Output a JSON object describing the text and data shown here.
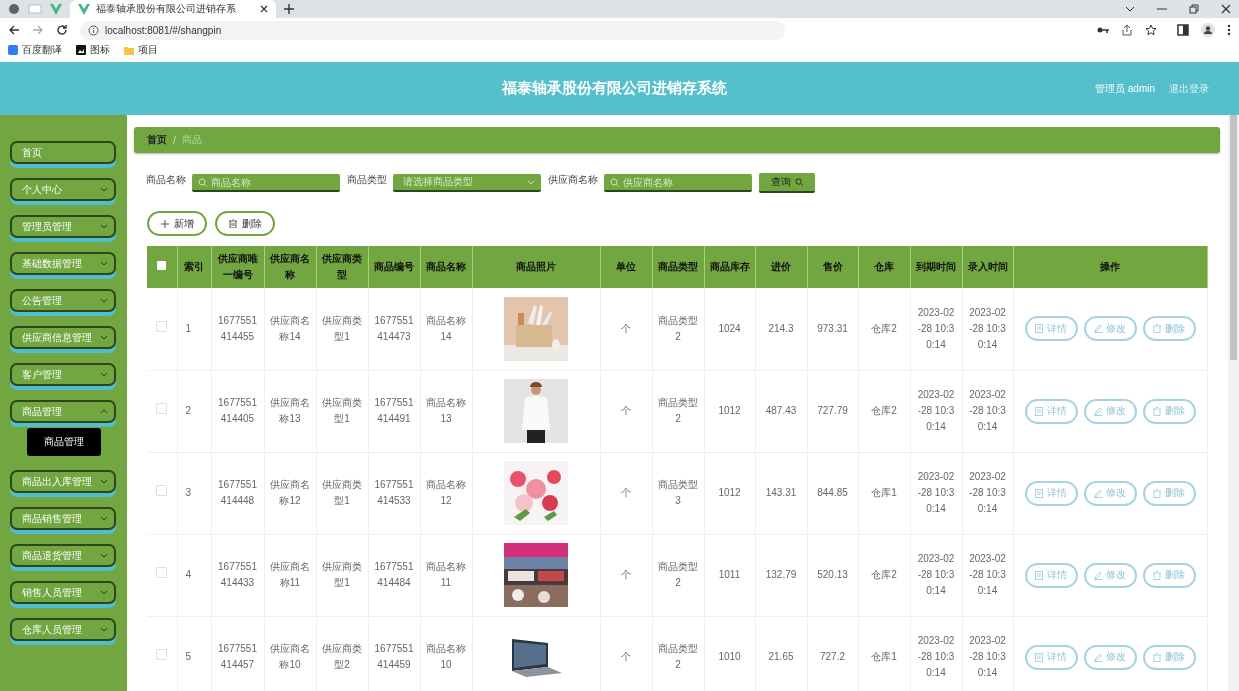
{
  "browser": {
    "tabs": [
      {
        "title": "福泰轴承股份有限公司进销存系",
        "selected": true
      }
    ],
    "url": "localhost:8081/#/shangpin",
    "bookmarks": [
      "百度翻译",
      "图标",
      "项目"
    ]
  },
  "header": {
    "title": "福泰轴承股份有限公司进销存系统",
    "user": "管理员 admin",
    "logout": "退出登录"
  },
  "sidebar": {
    "items": [
      {
        "label": "首页",
        "has_arrow": false
      },
      {
        "label": "个人中心",
        "has_arrow": true,
        "expanded": false
      },
      {
        "label": "管理员管理",
        "has_arrow": true,
        "expanded": false
      },
      {
        "label": "基础数据管理",
        "has_arrow": true,
        "expanded": false
      },
      {
        "label": "公告管理",
        "has_arrow": true,
        "expanded": false
      },
      {
        "label": "供应商信息管理",
        "has_arrow": true,
        "expanded": false
      },
      {
        "label": "客户管理",
        "has_arrow": true,
        "expanded": false
      },
      {
        "label": "商品管理",
        "has_arrow": true,
        "expanded": true,
        "children": [
          {
            "label": "商品管理",
            "selected": true
          }
        ]
      },
      {
        "label": "商品出入库管理",
        "has_arrow": true,
        "expanded": false
      },
      {
        "label": "商品销售管理",
        "has_arrow": true,
        "expanded": false
      },
      {
        "label": "商品退货管理",
        "has_arrow": true,
        "expanded": false
      },
      {
        "label": "销售人员管理",
        "has_arrow": true,
        "expanded": false
      },
      {
        "label": "仓库人员管理",
        "has_arrow": true,
        "expanded": false
      }
    ]
  },
  "breadcrumb": {
    "items": [
      "首页",
      "商品"
    ],
    "separator": "/"
  },
  "search": {
    "fields": [
      {
        "label": "商品名称",
        "placeholder": "商品名称",
        "kind": "text"
      },
      {
        "label": "商品类型",
        "placeholder": "请选择商品类型",
        "kind": "select"
      },
      {
        "label": "供应商名称",
        "placeholder": "供应商名称",
        "kind": "text"
      }
    ],
    "button": "查询"
  },
  "actions": [
    {
      "label": "新增",
      "kind": "add"
    },
    {
      "label": "删除",
      "kind": "delete"
    }
  ],
  "table": {
    "all_selected": false,
    "columns": [
      "索引",
      "供应商唯一编号",
      "供应商名称",
      "供应商类型",
      "商品编号",
      "商品名称",
      "商品照片",
      "单位",
      "商品类型",
      "商品库存",
      "进价",
      "售价",
      "仓库",
      "到期时间",
      "录入时间",
      "操作"
    ],
    "rows": [
      {
        "selected": false,
        "cells": [
          "1",
          "1677551414455",
          "供应商名称14",
          "供应商类型1",
          "1677551414473",
          "商品名称14",
          {
            "kind": "picture"
          },
          "个",
          "商品类型2",
          "1024",
          "214.3",
          "973.31",
          "仓库2",
          "2023-02-28 10:30:14",
          "2023-02-28 10:30:14"
        ],
        "actions": [
          "详情",
          "修改",
          "删除"
        ]
      },
      {
        "selected": false,
        "cells": [
          "2",
          "1677551414405",
          "供应商名称13",
          "供应商类型1",
          "1677551414491",
          "商品名称13",
          {
            "kind": "picture"
          },
          "个",
          "商品类型2",
          "1012",
          "487.43",
          "727.79",
          "仓库2",
          "2023-02-28 10:30:14",
          "2023-02-28 10:30:14"
        ],
        "actions": [
          "详情",
          "修改",
          "删除"
        ]
      },
      {
        "selected": false,
        "cells": [
          "3",
          "1677551414448",
          "供应商名称12",
          "供应商类型1",
          "1677551414533",
          "商品名称12",
          {
            "kind": "picture"
          },
          "个",
          "商品类型3",
          "1012",
          "143.31",
          "844.85",
          "仓库1",
          "2023-02-28 10:30:14",
          "2023-02-28 10:30:14"
        ],
        "actions": [
          "详情",
          "修改",
          "删除"
        ]
      },
      {
        "selected": false,
        "cells": [
          "4",
          "1677551414433",
          "供应商名称11",
          "供应商类型1",
          "1677551414484",
          "商品名称11",
          {
            "kind": "picture"
          },
          "个",
          "商品类型2",
          "1011",
          "132.79",
          "520.13",
          "仓库2",
          "2023-02-28 10:30:14",
          "2023-02-28 10:30:14"
        ],
        "actions": [
          "详情",
          "修改",
          "删除"
        ]
      },
      {
        "selected": false,
        "cells": [
          "5",
          "1677551414457",
          "供应商名称10",
          "供应商类型2",
          "1677551414459",
          "商品名称10",
          {
            "kind": "picture"
          },
          "个",
          "商品类型2",
          "1010",
          "21.65",
          "727.2",
          "仓库1",
          "2023-02-28 10:30:14",
          "2023-02-28 10:30:14"
        ],
        "actions": [
          "详情",
          "修改",
          "删除"
        ]
      }
    ]
  }
}
